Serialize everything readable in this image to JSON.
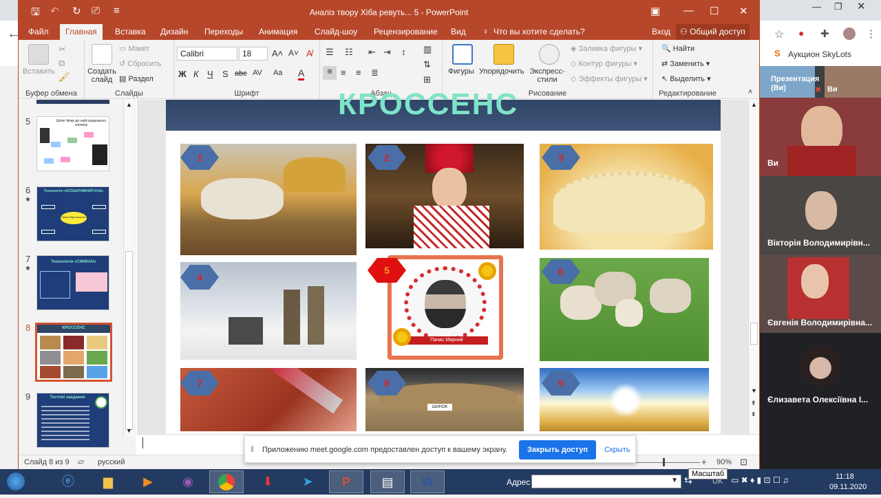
{
  "window": {
    "title": "Аналіз твору Хіба ревуть... 5 - PowerPoint"
  },
  "tabs": {
    "file": "Файл",
    "home": "Главная",
    "insert": "Вставка",
    "design": "Дизайн",
    "transitions": "Переходы",
    "animation": "Анимация",
    "slideshow": "Слайд-шоу",
    "review": "Рецензирование",
    "view": "Вид",
    "tellme": "Что вы хотите сделать?",
    "signin": "Вход",
    "share": "Общий доступ"
  },
  "ribbon": {
    "clipboard": {
      "paste": "Вставить",
      "label": "Буфер обмена"
    },
    "slides": {
      "new_slide": "Создать слайд",
      "layout": "Макет",
      "reset": "Сбросить",
      "section": "Раздел",
      "label": "Слайды"
    },
    "font": {
      "name": "Calibri",
      "size": "18",
      "bold": "Ж",
      "italic": "К",
      "underline": "Ч",
      "shadow": "S",
      "strike": "abc",
      "spacing": "AV",
      "case": "Aa",
      "color": "A",
      "label": "Шрифт"
    },
    "paragraph": {
      "label": "Абзац"
    },
    "drawing": {
      "shapes": "Фигуры",
      "arrange": "Упорядочить",
      "quick_styles": "Экспресс-стили",
      "fill": "Заливка фигуры",
      "outline": "Контур фигуры",
      "effects": "Эффекты фигуры",
      "label": "Рисование"
    },
    "editing": {
      "find": "Найти",
      "replace": "Заменить",
      "select": "Выделить",
      "label": "Редактирование"
    }
  },
  "thumbnails": [
    {
      "num": "5",
      "star": "",
      "caption": "Шлях Чіпки до найстрашнішого злочину"
    },
    {
      "num": "6",
      "star": "★",
      "caption": "Технологія «АСОЦІАТИВНИЙ КУЩ»",
      "center": "Чіпка Варениченко"
    },
    {
      "num": "7",
      "star": "★",
      "caption": "Технологія «СИНКАН»"
    },
    {
      "num": "8",
      "star": "",
      "caption": "КРОССЕНС"
    },
    {
      "num": "9",
      "star": "",
      "caption": "Тестові завдання"
    }
  ],
  "slide": {
    "title": "КРОССЕНС",
    "cells": [
      {
        "n": "1",
        "desc": "oxen-cart"
      },
      {
        "n": "2",
        "desc": "ukrainian-woman"
      },
      {
        "n": "3",
        "desc": "varenyk"
      },
      {
        "n": "4",
        "desc": "winter-scene"
      },
      {
        "n": "5",
        "desc": "panas-myrnyi-portrait",
        "caption": "Панас Мирний"
      },
      {
        "n": "6",
        "desc": "sheep-flock"
      },
      {
        "n": "7",
        "desc": "knife-blood"
      },
      {
        "n": "8",
        "desc": "thatched-house",
        "sign": "ШИНОК"
      },
      {
        "n": "9",
        "desc": "sun-field"
      }
    ]
  },
  "status": {
    "slide_info": "Слайд 8 из 9",
    "language": "русский",
    "zoom": "90%"
  },
  "share_bar": {
    "message": "Приложению meet.google.com предоставлен доступ к вашему экрану.",
    "stop": "Закрыть доступ",
    "hide": "Скрыть"
  },
  "browser": {
    "bookmark": "Аукцион SkyLots"
  },
  "meet": {
    "participants": [
      {
        "name": "Презентация (Ви)",
        "name2": "Ви"
      },
      {
        "name": "Ви"
      },
      {
        "name": "Вікторія Володимирівн..."
      },
      {
        "name": "Євгенія Володимирівна..."
      },
      {
        "name": "Єлизавета Олексіївна І..."
      }
    ]
  },
  "taskbar": {
    "address_label": "Адрес",
    "lang": "UK",
    "time": "11:18",
    "date": "09.11.2020",
    "tooltip": "Масштаб"
  }
}
